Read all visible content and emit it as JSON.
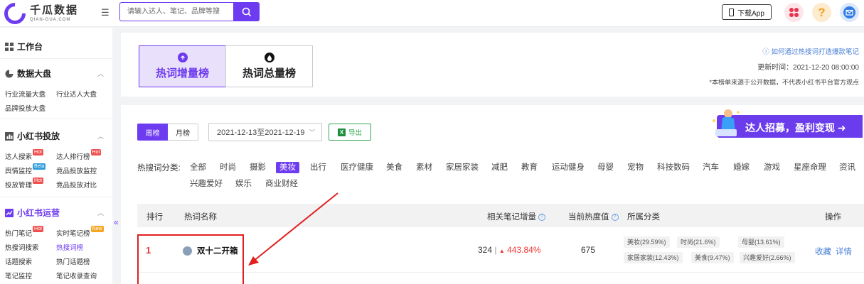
{
  "header": {
    "logo_cn": "千瓜数据",
    "logo_en": "QIAN-GUA.COM",
    "search_placeholder": "请输入达人、笔记、品牌等搜",
    "download_label": "下载App"
  },
  "sidebar": {
    "workbench": "工作台",
    "sections": [
      {
        "title": "数据大盘",
        "links": [
          "行业流量大盘",
          "行业达人大盘",
          "品牌投放大盘"
        ]
      },
      {
        "title": "小红书投放",
        "links": [
          "达人搜索",
          "达人排行榜",
          "舆情监控",
          "竞品投放监控",
          "投放管理",
          "竞品投放对比"
        ]
      },
      {
        "title": "小红书运营",
        "links": [
          "热门笔记",
          "实时笔记榜",
          "热搜词搜索",
          "热搜词榜",
          "话题搜索",
          "热门话题榜",
          "笔记监控",
          "笔记收录查询"
        ]
      }
    ],
    "tags": {
      "hot": "Hot",
      "beta": "Beta",
      "new": "New"
    },
    "collapse": "«"
  },
  "topcard": {
    "tab_active": "热词增量榜",
    "tab_inactive": "热词总量榜",
    "howto": "如何通过热搜词打造爆款笔记",
    "update_time": "更新时间：2021-12-20 08:00:00",
    "disclaimer": "*本榜单来源于公开数据，不代表小红书平台官方观点"
  },
  "filters": {
    "week": "周榜",
    "month": "月榜",
    "date_range": "2021-12-13至2021-12-19",
    "export": "导出",
    "banner": "达人招募，盈利变现"
  },
  "categories": {
    "label": "热搜词分类:",
    "items": [
      "全部",
      "时尚",
      "摄影",
      "美妆",
      "出行",
      "医疗健康",
      "美食",
      "素材",
      "家居家装",
      "减肥",
      "教育",
      "运动健身",
      "母婴",
      "宠物",
      "科技数码",
      "汽车",
      "婚嫁",
      "游戏",
      "星座命理",
      "资讯",
      "兴趣爱好",
      "娱乐",
      "商业财经"
    ],
    "active": "美妆"
  },
  "table": {
    "headers": {
      "rank": "排行",
      "name": "热词名称",
      "increase": "相关笔记增量",
      "heat": "当前热度值",
      "category": "所属分类",
      "action": "操作"
    },
    "rows": [
      {
        "rank": "1",
        "keyword": "双十二开箱",
        "increase": "324",
        "increase_pct": "443.84%",
        "heat": "675",
        "tags": [
          "美妆(29.59%)",
          "时尚(21.6%)",
          "母婴(13.61%)",
          "家居家装(12.43%)",
          "美食(9.47%)",
          "兴趣爱好(2.66%)"
        ],
        "actions": [
          "收藏",
          "详情"
        ]
      }
    ]
  },
  "colors": {
    "accent": "#6e3cf0",
    "hot_red": "#e33",
    "link_blue": "#4a7fd6",
    "export_green": "#33a852"
  }
}
